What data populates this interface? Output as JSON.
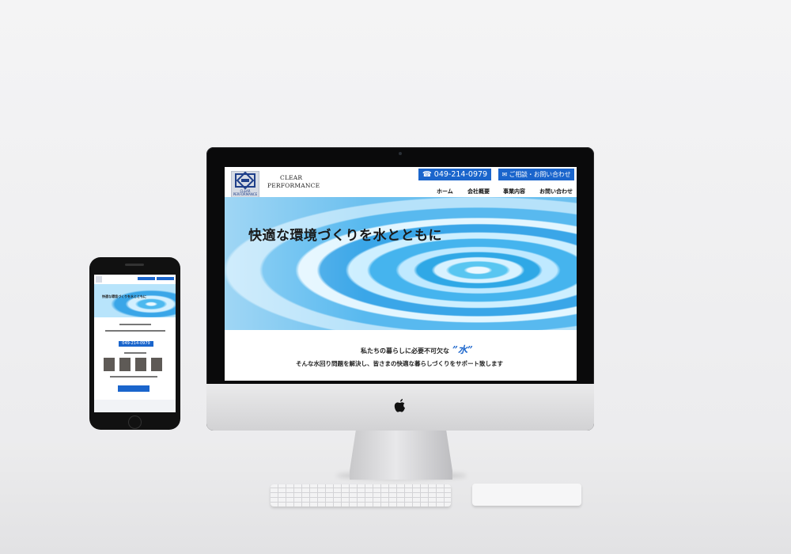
{
  "brand": {
    "logo_text_1": "CLEAR",
    "logo_text_2": "PERFORMANCE",
    "name_line1": "CLEAR",
    "name_line2": "PERFORMANCE"
  },
  "header": {
    "phone": "049-214-0979",
    "contact_label": "ご相談・お問い合わせ"
  },
  "nav": {
    "items": [
      {
        "label": "ホーム"
      },
      {
        "label": "会社概要"
      },
      {
        "label": "事業内容"
      },
      {
        "label": "お問い合わせ"
      }
    ]
  },
  "hero": {
    "title": "快適な環境づくりを水とともに"
  },
  "intro": {
    "line1_prefix": "私たちの暮らしに必要不可欠な",
    "line1_emphasis": "”水”",
    "line2": "そんな水回り問題を解決し、皆さまの快適な暮らしづくりをサポート致します"
  },
  "mobile": {
    "hero_title": "快適な環境づくりを水とともに",
    "phone": "049-214-0979"
  },
  "colors": {
    "accent": "#1a65cc"
  }
}
